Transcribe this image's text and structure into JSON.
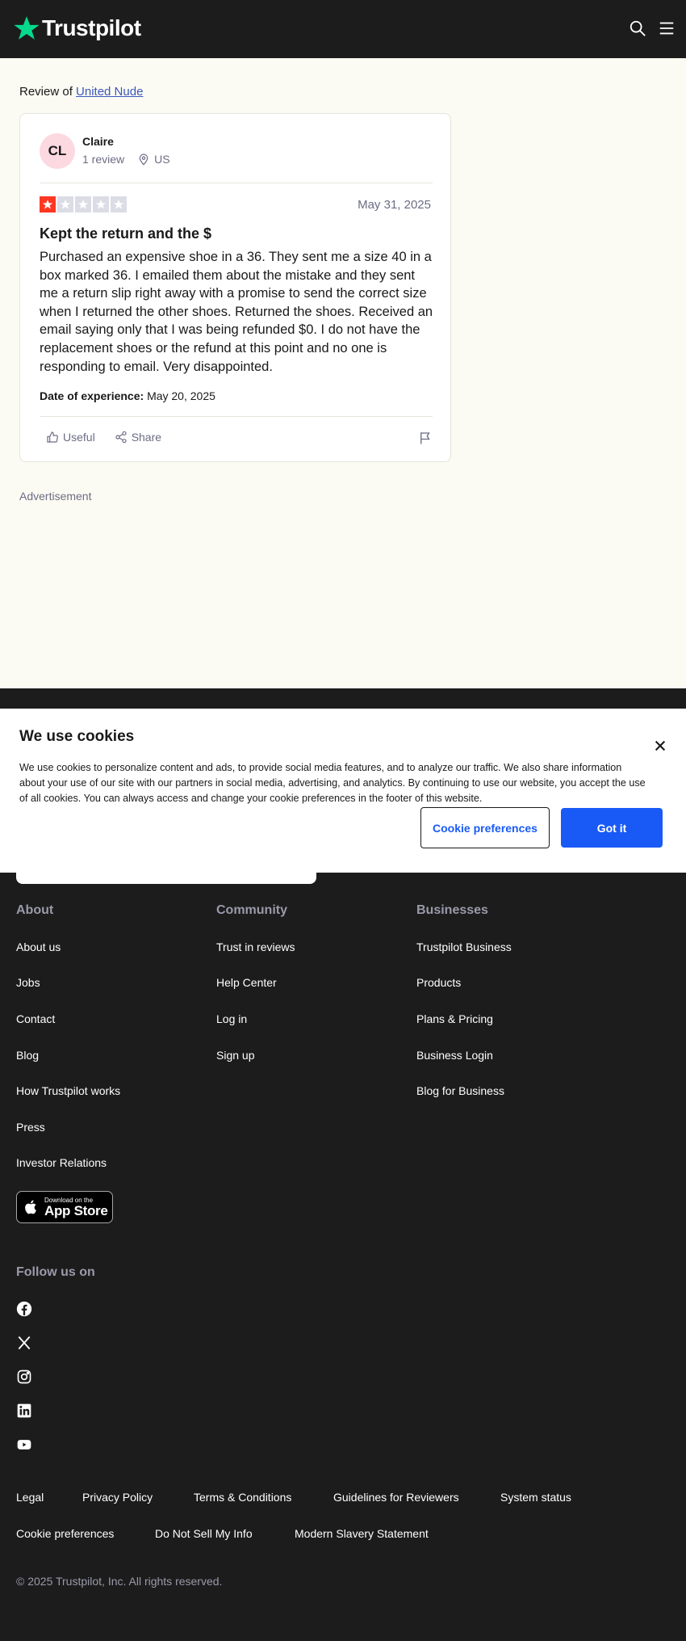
{
  "header": {
    "brand": "Trustpilot",
    "search_icon": "search-icon",
    "menu_icon": "hamburger-menu-icon"
  },
  "review_of": {
    "prefix": "Review of",
    "company": "United Nude"
  },
  "review": {
    "avatar_initials": "CL",
    "reviewer_name": "Claire",
    "review_count": "1 review",
    "country": "US",
    "rating": 1,
    "max_rating": 5,
    "date": "May 31, 2025",
    "title": "Kept the return and the $",
    "body": "Purchased an expensive shoe in a 36. They sent me a size 40 in a box marked 36. I emailed them about the mistake and they sent me a return slip right away with a promise to send the correct size when I returned the other shoes. Returned the shoes. Received an email saying only that I was being refunded $0. I do not have the replacement shoes or the refund at this point and no one is responding to email. Very disappointed.",
    "experience_label": "Date of experience:",
    "experience_date": "May 20, 2025",
    "useful_label": "Useful",
    "share_label": "Share"
  },
  "advertisement_label": "Advertisement",
  "cookie_banner": {
    "title": "We use cookies",
    "text": "We use cookies to personalize content and ads, to provide social media features, and to analyze our traffic. We also share information about your use of our site with our partners in social media, advertising, and analytics. By continuing to use our website, you accept the use of all cookies. You can always access and change your cookie preferences in the footer of this website.",
    "preferences_button": "Cookie preferences",
    "accept_button": "Got it"
  },
  "footer": {
    "columns": [
      {
        "heading": "About",
        "links": [
          "About us",
          "Jobs",
          "Contact",
          "Blog",
          "How Trustpilot works",
          "Press",
          "Investor Relations"
        ]
      },
      {
        "heading": "Community",
        "links": [
          "Trust in reviews",
          "Help Center",
          "Log in",
          "Sign up"
        ]
      },
      {
        "heading": "Businesses",
        "links": [
          "Trustpilot Business",
          "Products",
          "Plans & Pricing",
          "Business Login",
          "Blog for Business"
        ]
      }
    ],
    "app_store": {
      "small": "Download on the",
      "big": "App Store"
    },
    "follow_label": "Follow us on",
    "social": [
      "facebook-icon",
      "x-icon",
      "instagram-icon",
      "linkedin-icon",
      "youtube-icon"
    ],
    "legal_row1": [
      "Legal",
      "Privacy Policy",
      "Terms & Conditions",
      "Guidelines for Reviewers",
      "System status"
    ],
    "legal_row2": [
      "Cookie preferences",
      "Do Not Sell My Info",
      "Modern Slavery Statement"
    ],
    "copyright": "© 2025 Trustpilot, Inc. All rights reserved."
  },
  "colors": {
    "brand_green": "#04da8d",
    "star_red": "#ff3722",
    "link_blue": "#3c57bc",
    "button_blue": "#195af6",
    "background_cream": "#fcfbf3",
    "dark": "#1c1c1c"
  }
}
